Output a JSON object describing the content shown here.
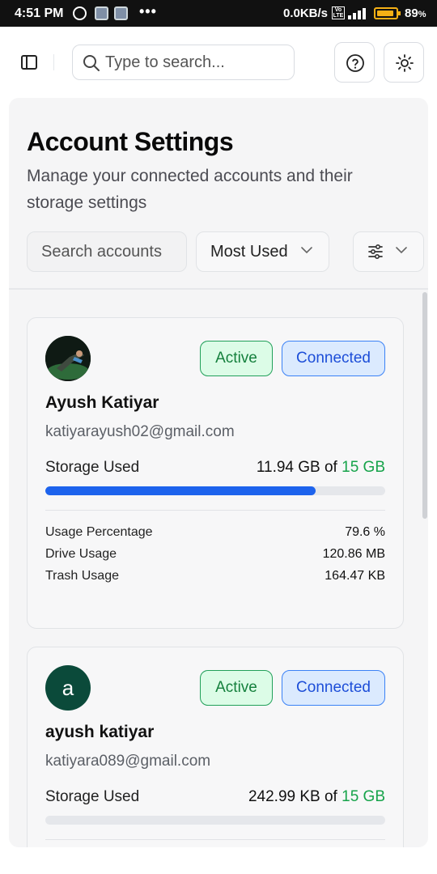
{
  "status_bar": {
    "time": "4:51 PM",
    "dots": "•••",
    "net_speed": "0.0KB/s",
    "volte": "Vo LTE",
    "battery_percent": "89",
    "battery_suffix": "%",
    "battery_level": 0.89
  },
  "header": {
    "search_placeholder": "Type to search...",
    "help_icon": "help-circle-icon",
    "theme_icon": "sun-icon"
  },
  "page": {
    "title": "Account Settings",
    "subtitle": "Manage your connected accounts and their storage settings"
  },
  "filters": {
    "search_placeholder": "Search accounts",
    "sort_selected": "Most Used"
  },
  "accounts": [
    {
      "avatar_type": "photo",
      "avatar_letter": "",
      "status_badge": "Active",
      "connection_badge": "Connected",
      "name": "Ayush Katiyar",
      "email": "katiyarayush02@gmail.com",
      "storage_label": "Storage Used",
      "storage_used": "11.94 GB of ",
      "storage_total": "15 GB",
      "usage_fraction": 0.796,
      "stats": [
        {
          "label": "Usage Percentage",
          "value": "79.6 %"
        },
        {
          "label": "Drive Usage",
          "value": "120.86 MB"
        },
        {
          "label": "Trash Usage",
          "value": "164.47 KB"
        }
      ]
    },
    {
      "avatar_type": "letter",
      "avatar_letter": "a",
      "status_badge": "Active",
      "connection_badge": "Connected",
      "name": "ayush katiyar",
      "email": "katiyara089@gmail.com",
      "storage_label": "Storage Used",
      "storage_used": "242.99 KB of ",
      "storage_total": "15 GB",
      "usage_fraction": 0.0
    }
  ],
  "colors": {
    "accent_blue": "#1d63ed",
    "active_green": "#15803d",
    "connected_blue": "#1d4ed8",
    "storage_total_green": "#16a34a"
  }
}
